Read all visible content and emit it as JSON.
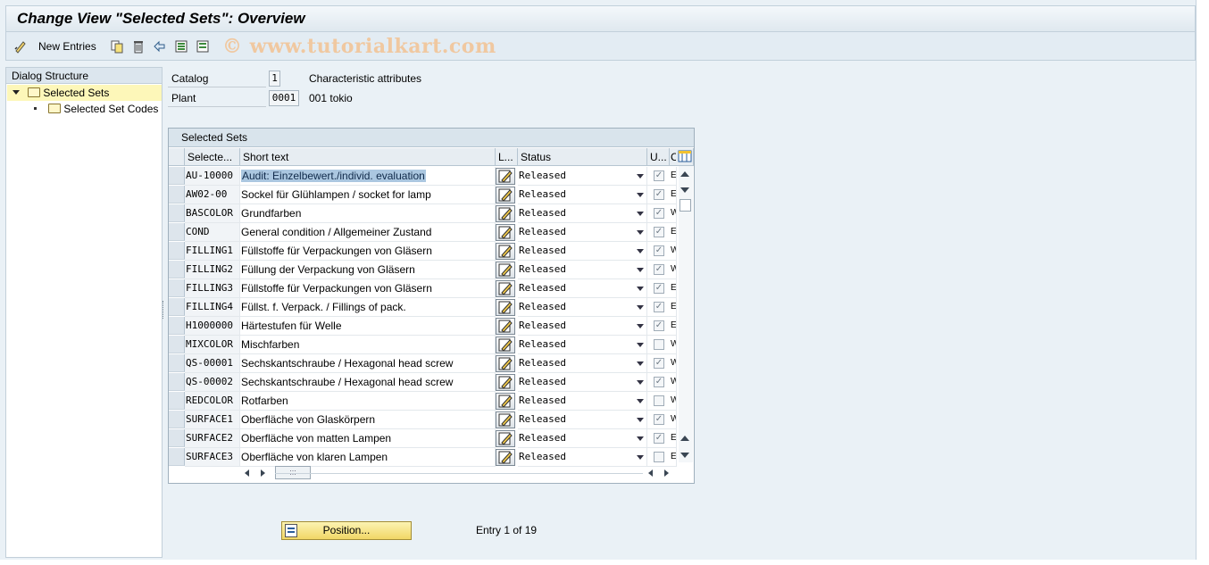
{
  "title": "Change View \"Selected Sets\": Overview",
  "toolbar": {
    "new_entries": "New Entries",
    "watermark": "© www.tutorialkart.com"
  },
  "dialog_structure": {
    "header": "Dialog Structure",
    "items": [
      {
        "label": "Selected Sets",
        "selected": true
      },
      {
        "label": "Selected Set Codes",
        "selected": false
      }
    ]
  },
  "fields": {
    "catalog_label": "Catalog",
    "catalog_value": "1",
    "catalog_text": "Characteristic attributes",
    "plant_label": "Plant",
    "plant_value": "0001",
    "plant_text": "001 tokio"
  },
  "table": {
    "caption": "Selected Sets",
    "headers": [
      "Selecte...",
      "Short text",
      "L...",
      "Status",
      "U...",
      "C"
    ],
    "rows": [
      {
        "code": "AU-10000",
        "text": "Audit: Einzelbewert./individ. evaluation",
        "status": "Released",
        "checked": true,
        "c": "E"
      },
      {
        "code": "AW02-00",
        "text": "Sockel für Glühlampen / socket for lamp",
        "status": "Released",
        "checked": true,
        "c": "E"
      },
      {
        "code": "BASCOLOR",
        "text": "Grundfarben",
        "status": "Released",
        "checked": true,
        "c": "W"
      },
      {
        "code": "COND",
        "text": "General condition / Allgemeiner Zustand",
        "status": "Released",
        "checked": true,
        "c": "E"
      },
      {
        "code": "FILLING1",
        "text": "Füllstoffe für Verpackungen von Gläsern",
        "status": "Released",
        "checked": true,
        "c": "W"
      },
      {
        "code": "FILLING2",
        "text": "Füllung der Verpackung von Gläsern",
        "status": "Released",
        "checked": true,
        "c": "W"
      },
      {
        "code": "FILLING3",
        "text": "Füllstoffe für Verpackungen von Gläsern",
        "status": "Released",
        "checked": true,
        "c": "E"
      },
      {
        "code": "FILLING4",
        "text": "Füllst. f. Verpack. / Fillings of pack.",
        "status": "Released",
        "checked": true,
        "c": "E"
      },
      {
        "code": "H1000000",
        "text": "Härtestufen für Welle",
        "status": "Released",
        "checked": true,
        "c": "E"
      },
      {
        "code": "MIXCOLOR",
        "text": "Mischfarben",
        "status": "Released",
        "checked": false,
        "c": "W"
      },
      {
        "code": "QS-00001",
        "text": "Sechskantschraube / Hexagonal head screw",
        "status": "Released",
        "checked": true,
        "c": "W"
      },
      {
        "code": "QS-00002",
        "text": "Sechskantschraube / Hexagonal head screw",
        "status": "Released",
        "checked": true,
        "c": "W"
      },
      {
        "code": "REDCOLOR",
        "text": "Rotfarben",
        "status": "Released",
        "checked": false,
        "c": "W"
      },
      {
        "code": "SURFACE1",
        "text": "Oberfläche von Glaskörpern",
        "status": "Released",
        "checked": true,
        "c": "W"
      },
      {
        "code": "SURFACE2",
        "text": "Oberfläche von matten Lampen",
        "status": "Released",
        "checked": true,
        "c": "E"
      },
      {
        "code": "SURFACE3",
        "text": "Oberfläche von klaren Lampen",
        "status": "Released",
        "checked": false,
        "c": "E"
      }
    ]
  },
  "position_button": "Position...",
  "entry_info": "Entry 1 of 19"
}
